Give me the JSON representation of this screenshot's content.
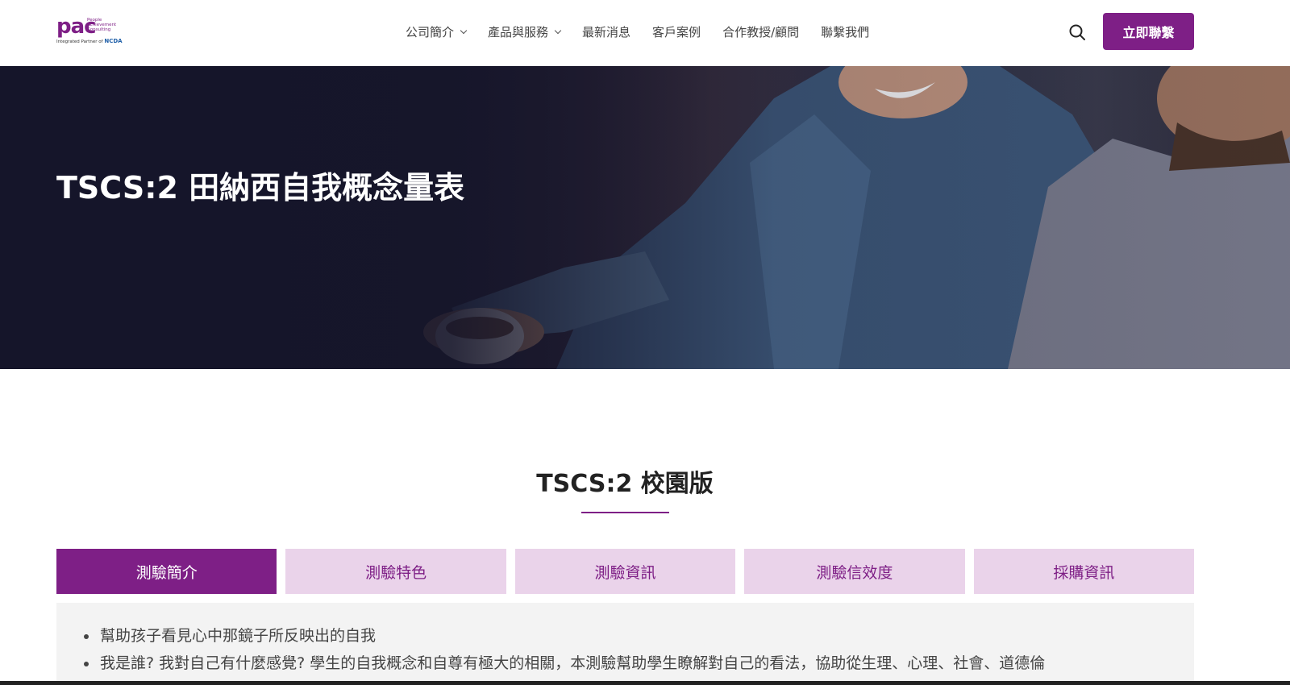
{
  "logo": {
    "text": "pac",
    "subtitle": "People Achievement Consulting",
    "partner_prefix": "Integrated Partner of",
    "partner_name": "NCDA"
  },
  "nav": {
    "items": [
      {
        "label": "公司簡介",
        "has_dropdown": true
      },
      {
        "label": "產品與服務",
        "has_dropdown": true
      },
      {
        "label": "最新消息",
        "has_dropdown": false
      },
      {
        "label": "客戶案例",
        "has_dropdown": false
      },
      {
        "label": "合作教授/顧問",
        "has_dropdown": false
      },
      {
        "label": "聯繫我們",
        "has_dropdown": false
      }
    ],
    "search_icon": "search-icon",
    "cta_label": "立即聯繫"
  },
  "hero": {
    "title": "TSCS:2 田納西自我概念量表"
  },
  "section": {
    "title": "TSCS:2 校園版",
    "tabs": [
      {
        "label": "測驗簡介",
        "active": true
      },
      {
        "label": "測驗特色",
        "active": false
      },
      {
        "label": "測驗資訊",
        "active": false
      },
      {
        "label": "測驗信效度",
        "active": false
      },
      {
        "label": "採購資訊",
        "active": false
      }
    ],
    "bullets": [
      "幫助孩子看見心中那鏡子所反映出的自我",
      "我是誰? 我對自己有什麼感覺? 學生的自我概念和自尊有極大的相關，本測驗幫助學生瞭解對自己的看法，協助從生理、心理、社會、道德倫"
    ]
  },
  "colors": {
    "brand": "#7e1f86",
    "tab_inactive_bg": "#ead3ea",
    "panel_bg": "#f3f3f3"
  }
}
